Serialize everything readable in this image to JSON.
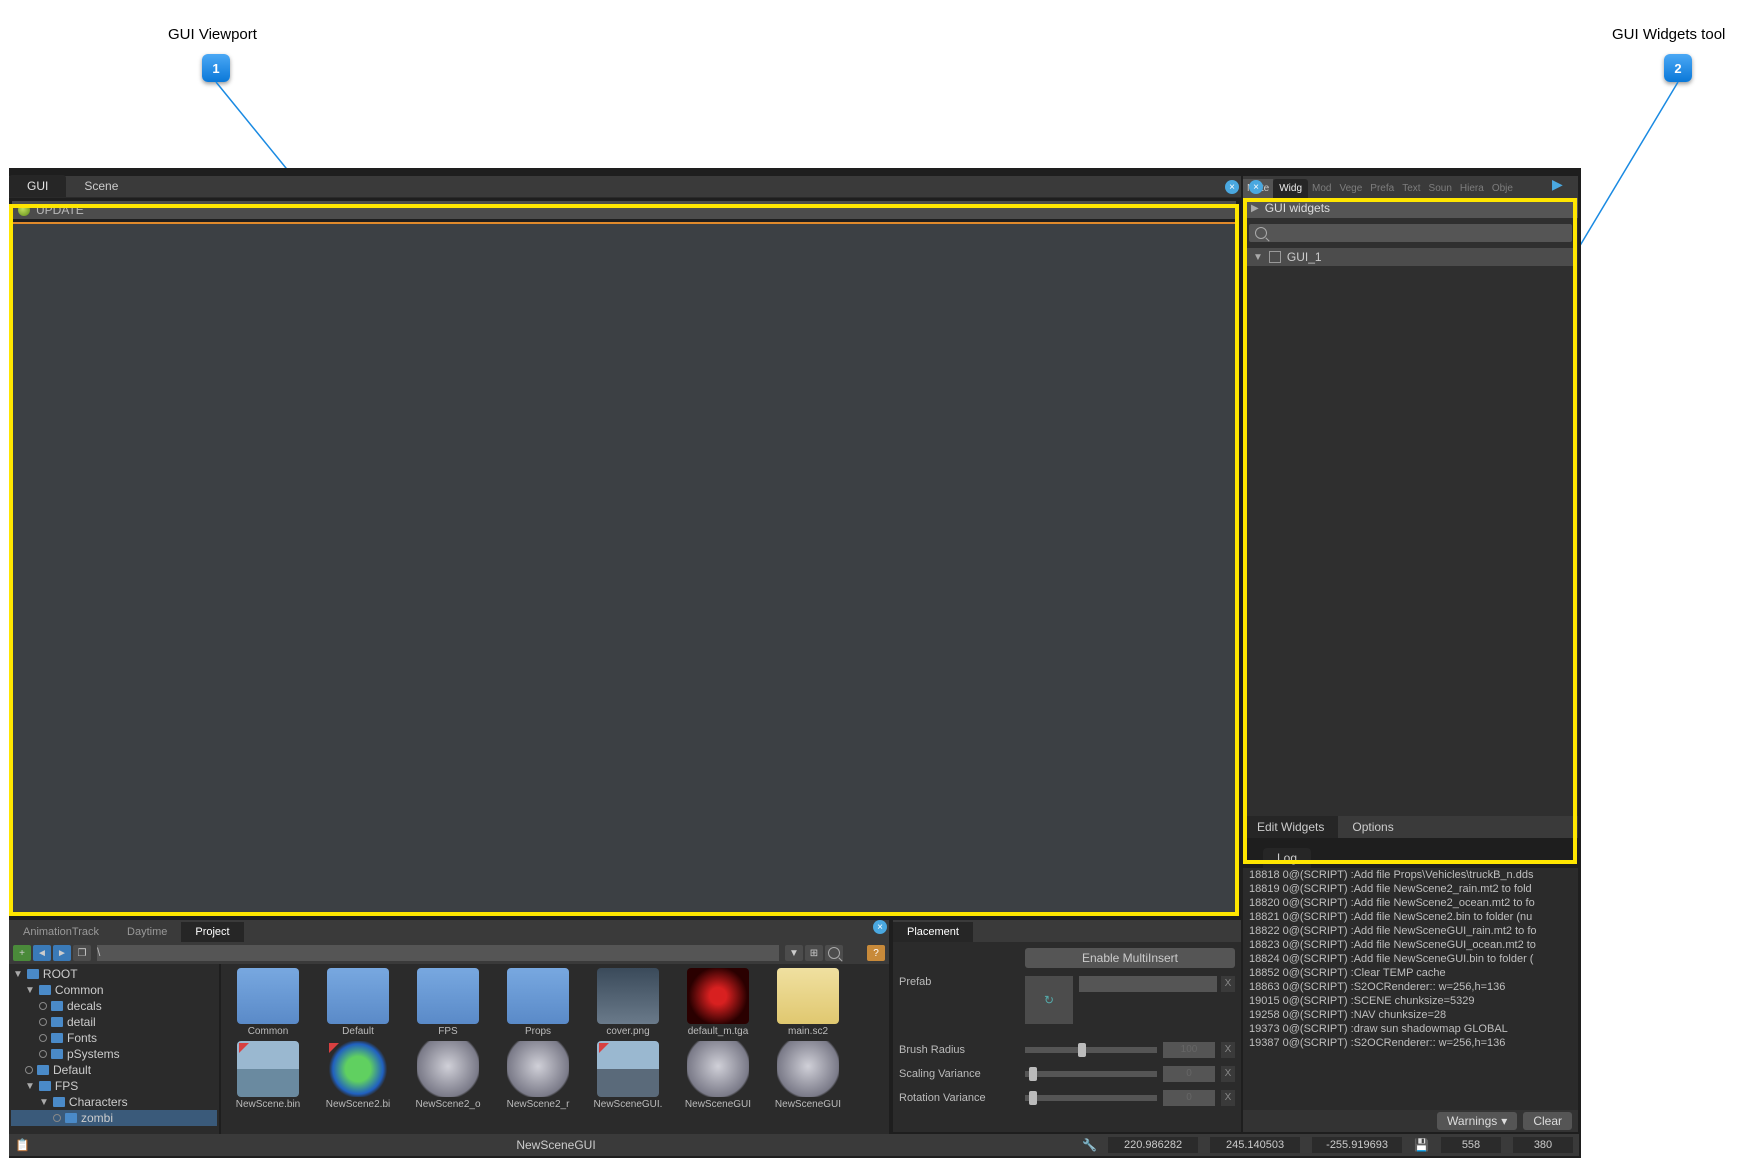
{
  "annotations": {
    "a1_label": "GUI Viewport",
    "a1_num": "1",
    "a2_label": "GUI Widgets tool",
    "a2_num": "2"
  },
  "vp_tabs": {
    "gui": "GUI",
    "scene": "Scene"
  },
  "update_label": "UPDATE",
  "right_tabs": {
    "mate": "Mate",
    "widg": "Widg",
    "mod": "Mod",
    "vege": "Vege",
    "prefa": "Prefa",
    "text": "Text",
    "soun": "Soun",
    "hiera": "Hiera",
    "obje": "Obje"
  },
  "right_panel": {
    "title": "GUI widgets",
    "search_placeholder": "",
    "tree_item": "GUI_1",
    "sub_edit": "Edit Widgets",
    "sub_options": "Options",
    "log_tab": "Log"
  },
  "log": [
    "18818 0@(SCRIPT) :Add file Props\\Vehicles\\truckB_n.dds",
    "18819 0@(SCRIPT) :Add file NewScene2_rain.mt2 to fold",
    "18820 0@(SCRIPT) :Add file NewScene2_ocean.mt2 to fo",
    "18821 0@(SCRIPT) :Add file NewScene2.bin to folder (nu",
    "18822 0@(SCRIPT) :Add file NewSceneGUI_rain.mt2 to fo",
    "18823 0@(SCRIPT) :Add file NewSceneGUI_ocean.mt2 to",
    "18824 0@(SCRIPT) :Add file NewSceneGUI.bin to folder (",
    "18852 0@(SCRIPT) :Clear TEMP cache",
    "18863 0@(SCRIPT) :S2OCRenderer:: w=256,h=136",
    "19015 0@(SCRIPT) :SCENE chunksize=5329",
    "19258 0@(SCRIPT) :NAV chunksize=28",
    "19373 0@(SCRIPT) :draw sun shadowmap GLOBAL",
    "19387 0@(SCRIPT) :S2OCRenderer:: w=256,h=136"
  ],
  "log_footer": {
    "warnings": "Warnings",
    "clear": "Clear"
  },
  "bl_tabs": {
    "anim": "AnimationTrack",
    "day": "Daytime",
    "proj": "Project"
  },
  "bl_addr": "\\",
  "tree": {
    "root": "ROOT",
    "common": "Common",
    "decals": "decals",
    "detail": "detail",
    "fonts": "Fonts",
    "psys": "pSystems",
    "default": "Default",
    "fps": "FPS",
    "chars": "Characters",
    "zombi": "zombi"
  },
  "grid_row1": [
    {
      "label": "Common",
      "kind": "folder"
    },
    {
      "label": "Default",
      "kind": "folder"
    },
    {
      "label": "FPS",
      "kind": "folder"
    },
    {
      "label": "Props",
      "kind": "folder"
    },
    {
      "label": "cover.png",
      "kind": "img1"
    },
    {
      "label": "default_m.tga",
      "kind": "img2"
    },
    {
      "label": "main.sc2",
      "kind": "note"
    }
  ],
  "grid_row2": [
    {
      "label": "NewScene.bin",
      "kind": "scene1"
    },
    {
      "label": "NewScene2.bi",
      "kind": "globe"
    },
    {
      "label": "NewScene2_o",
      "kind": "sphere"
    },
    {
      "label": "NewScene2_r",
      "kind": "sphere"
    },
    {
      "label": "NewSceneGUI.",
      "kind": "scene1"
    },
    {
      "label": "NewSceneGUI",
      "kind": "sphere"
    },
    {
      "label": "NewSceneGUI",
      "kind": "sphere"
    }
  ],
  "placement": {
    "title": "Placement",
    "enable": "Enable MultiInsert",
    "prefab": "Prefab",
    "brush": "Brush Radius",
    "brush_val": "100",
    "scale": "Scaling Variance",
    "scale_val": "0",
    "rot": "Rotation Variance",
    "rot_val": "0"
  },
  "status": {
    "file": "NewSceneGUI",
    "x": "220.986282",
    "y": "245.140503",
    "z": "-255.919693",
    "mem": "558",
    "mem2": "380"
  }
}
